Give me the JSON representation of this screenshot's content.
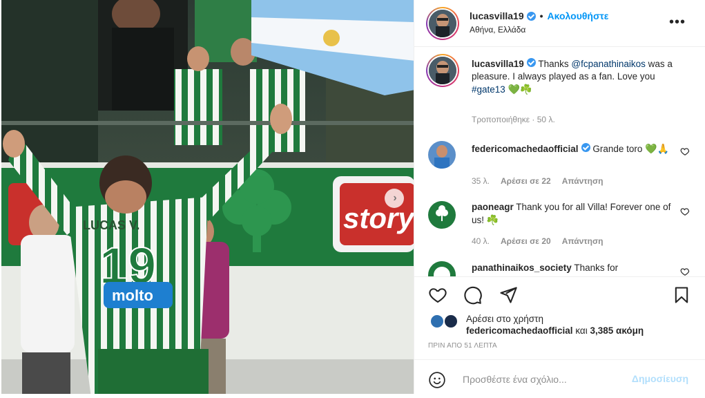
{
  "post": {
    "author": "lucasvilla19",
    "follow_label": "Ακολουθήστε",
    "separator": "•",
    "location": "Αθήνα, Ελλάδα",
    "more_icon": "more-options-icon",
    "caption": {
      "username": "lucasvilla19",
      "text_before": "Thanks",
      "mention": "@fcpanathinaikos",
      "text_after": "was a pleasure. I always played as a fan. Love you",
      "hashtag": "#gate13",
      "emojis": "💚☘️",
      "meta": "Τροποποιήθηκε · 50 λ."
    },
    "photo": {
      "banner_text": "story",
      "jersey_name": "LUCAS V.",
      "jersey_number": "19",
      "sponsor": "molto"
    }
  },
  "comments": [
    {
      "username": "federicomachedaofficial",
      "text": "Grande toro",
      "emojis": "💚🙏",
      "time": "35 λ.",
      "likes": "Αρέσει σε 22",
      "reply": "Απάντηση"
    },
    {
      "username": "paoneagr",
      "text": "Thank you for all Villa! Forever one of us!",
      "emojis": "☘️",
      "time": "40 λ.",
      "likes": "Αρέσει σε 20",
      "reply": "Απάντηση"
    },
    {
      "username": "panathinaikos_society",
      "text": "Thanks for"
    }
  ],
  "likes": {
    "prefix": "Αρέσει στο χρήστη",
    "first_user": "federicomachedaofficial",
    "connector": "και",
    "others": "3,385 ακόμη"
  },
  "time_ago": "ΠΡΙΝ ΑΠΟ 51 ΛΕΠΤΑ",
  "add_comment": {
    "placeholder": "Προσθέστε ένα σχόλιο...",
    "post_label": "Δημοσίευση"
  },
  "colors": {
    "accent": "#0095f6",
    "verified": "#3897f0",
    "muted": "#8e8e8e",
    "panathinaikos_green": "#1f7a3d"
  }
}
